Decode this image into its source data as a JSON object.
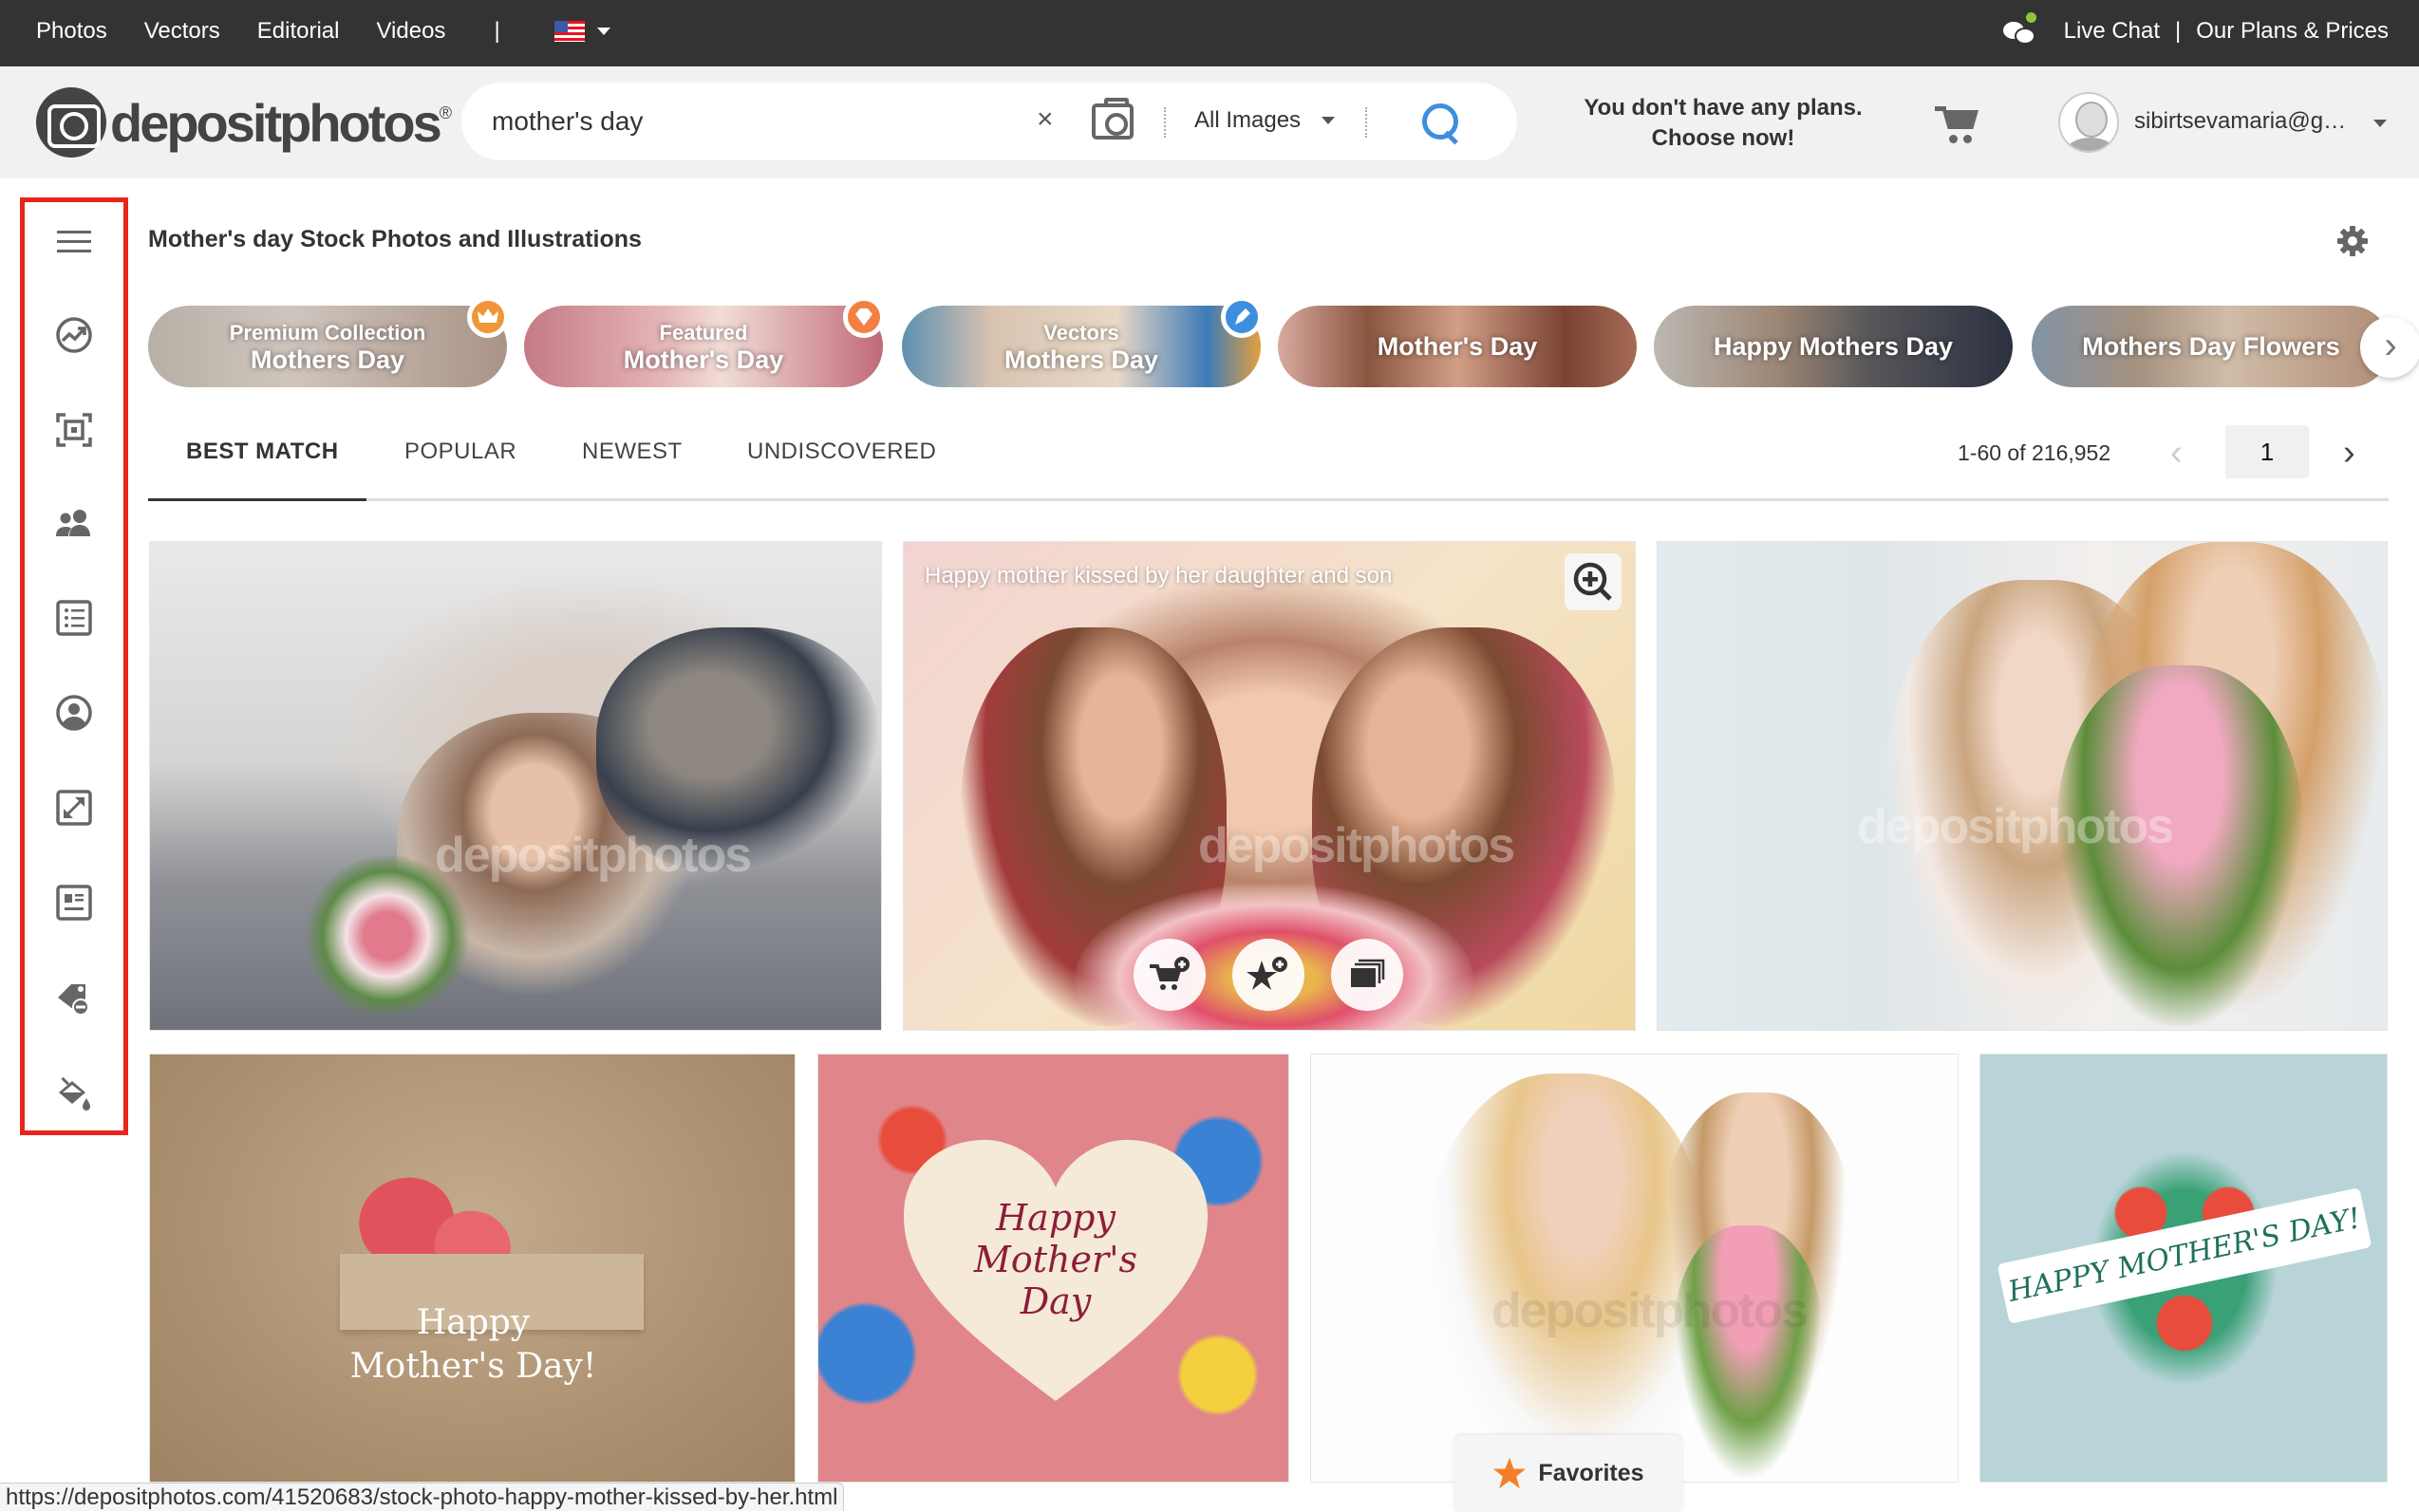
{
  "topbar": {
    "nav": [
      "Photos",
      "Vectors",
      "Editorial",
      "Videos"
    ],
    "separator": "|",
    "language_flag": "us-flag-icon",
    "live_chat": "Live Chat",
    "right_separator": "|",
    "plans_prices": "Our Plans & Prices"
  },
  "header": {
    "logo_text": "depositphotos",
    "logo_reg": "®",
    "search_value": "mother's day",
    "clear_icon": "×",
    "search_type": "All Images",
    "plans_line1": "You don't have any plans.",
    "plans_line2": "Choose now!",
    "user_email": "sibirtsevamaria@g…"
  },
  "sidebar": {
    "items": [
      "menu-icon",
      "trending-icon",
      "focus-icon",
      "people-icon",
      "list-icon",
      "account-icon",
      "resize-icon",
      "article-icon",
      "tag-remove-icon",
      "paint-bucket-icon"
    ]
  },
  "page": {
    "title": "Mother's day Stock Photos and Illustrations"
  },
  "chips": [
    {
      "line1": "Premium Collection",
      "line2": "Mothers Day",
      "badge": "crown-icon",
      "badge_color": "#f0953a"
    },
    {
      "line1": "Featured",
      "line2": "Mother's Day",
      "badge": "diamond-icon",
      "badge_color": "#f47f45"
    },
    {
      "line1": "Vectors",
      "line2": "Mothers Day",
      "badge": "pen-icon",
      "badge_color": "#3e8ede"
    },
    {
      "label": "Mother's Day"
    },
    {
      "label": "Happy Mothers Day"
    },
    {
      "label": "Mothers Day Flowers"
    }
  ],
  "tabs": [
    {
      "label": "BEST MATCH",
      "active": true
    },
    {
      "label": "POPULAR"
    },
    {
      "label": "NEWEST"
    },
    {
      "label": "UNDISCOVERED"
    }
  ],
  "pagination": {
    "count": "1-60 of 216,952",
    "page": "1",
    "prev": "‹",
    "next": "›"
  },
  "grid": {
    "hover_caption": "Happy mother kissed by her daughter and son",
    "watermark": "depositphotos",
    "card_texts": {
      "hearts": [
        "Happy",
        "Mother's Day!"
      ],
      "heart_vector": [
        "Happy",
        "Mother's",
        "Day"
      ],
      "banner": "HAPPY MOTHER'S DAY!"
    }
  },
  "statusbar": {
    "url": "https://depositphotos.com/41520683/stock-photo-happy-mother-kissed-by-her.html"
  },
  "favorites": {
    "label": "Favorites",
    "star_color": "#f47f2a"
  },
  "colors": {
    "topbar_bg": "#333333",
    "header_bg": "#f0f1f3",
    "accent_blue": "#3e8ede",
    "highlight_red": "#e8251c"
  }
}
